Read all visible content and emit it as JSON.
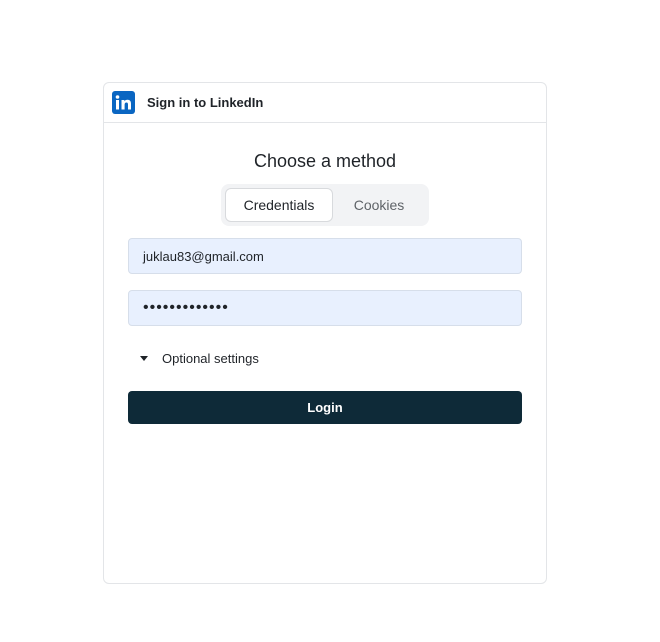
{
  "header": {
    "title": "Sign in to LinkedIn",
    "logo_icon": "linkedin-logo-icon",
    "logo_text": "in",
    "brand_color": "#0a66c2"
  },
  "main": {
    "heading": "Choose a method",
    "tabs": [
      {
        "label": "Credentials",
        "active": true
      },
      {
        "label": "Cookies",
        "active": false
      }
    ],
    "email_value": "juklau83@gmail.com",
    "password_value": "•••••••••••••",
    "optional_settings_label": "Optional settings",
    "login_label": "Login",
    "login_color": "#0e2a38"
  }
}
